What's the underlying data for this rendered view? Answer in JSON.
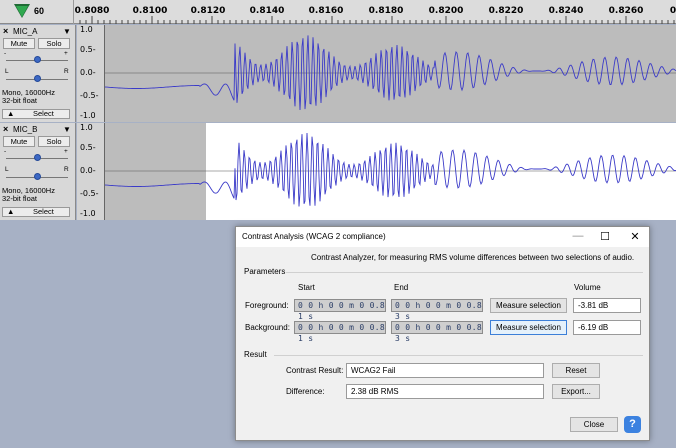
{
  "ruler": {
    "lead_label": "60",
    "ticks": [
      "0.8080",
      "0.8100",
      "0.8120",
      "0.8140",
      "0.8160",
      "0.8180",
      "0.8200",
      "0.8220",
      "0.8240",
      "0.8260",
      "0"
    ]
  },
  "tracks": [
    {
      "name": "MIC_A",
      "close": "×",
      "menu": "▼",
      "mute": "Mute",
      "solo": "Solo",
      "gain_minus": "-",
      "gain_plus": "+",
      "pan_left": "L",
      "pan_right": "R",
      "info_line1": "Mono, 16000Hz",
      "info_line2": "32-bit float",
      "collapse": "▲",
      "select": "Select",
      "scale": [
        "1.0",
        "0.5-",
        "0.0-",
        "-0.5-",
        "-1.0"
      ],
      "selected": false
    },
    {
      "name": "MIC_B",
      "close": "×",
      "menu": "▼",
      "mute": "Mute",
      "solo": "Solo",
      "gain_minus": "-",
      "gain_plus": "+",
      "pan_left": "L",
      "pan_right": "R",
      "info_line1": "Mono, 16000Hz",
      "info_line2": "32-bit float",
      "collapse": "▲",
      "select": "Select",
      "scale": [
        "1.0",
        "0.5-",
        "0.0-",
        "-0.5-",
        "-1.0"
      ],
      "selected": true
    }
  ],
  "dialog": {
    "title": "Contrast Analysis (WCAG 2 compliance)",
    "minimize": "—",
    "maximize": "☐",
    "close": "✕",
    "description": "Contrast Analyzer, for measuring RMS volume differences between two selections of audio.",
    "parameters_label": "Parameters",
    "col_start": "Start",
    "col_end": "End",
    "col_volume": "Volume",
    "foreground_label": "Foreground:",
    "background_label": "Background:",
    "fg_start": "0 0 h 0 0 m 0 0.8 1 s",
    "fg_end": "0 0 h 0 0 m 0 0.8 3 s",
    "bg_start": "0 0 h 0 0 m 0 0.8 1 s",
    "bg_end": "0 0 h 0 0 m 0 0.8 3 s",
    "measure_label": "Measure selection",
    "fg_volume": "-3.81 dB",
    "bg_volume": "-6.19 dB",
    "result_label": "Result",
    "contrast_result_label": "Contrast Result:",
    "contrast_result_value": "WCAG2 Fail",
    "difference_label": "Difference:",
    "difference_value": "2.38 dB RMS",
    "reset_label": "Reset",
    "export_label": "Export...",
    "close_label": "Close",
    "help_label": "?"
  },
  "colors": {
    "waveform": "#3b3bc8",
    "selection": "#ffffff",
    "unselected": "#bcbcbc",
    "workspace": "#a7b1c5"
  }
}
